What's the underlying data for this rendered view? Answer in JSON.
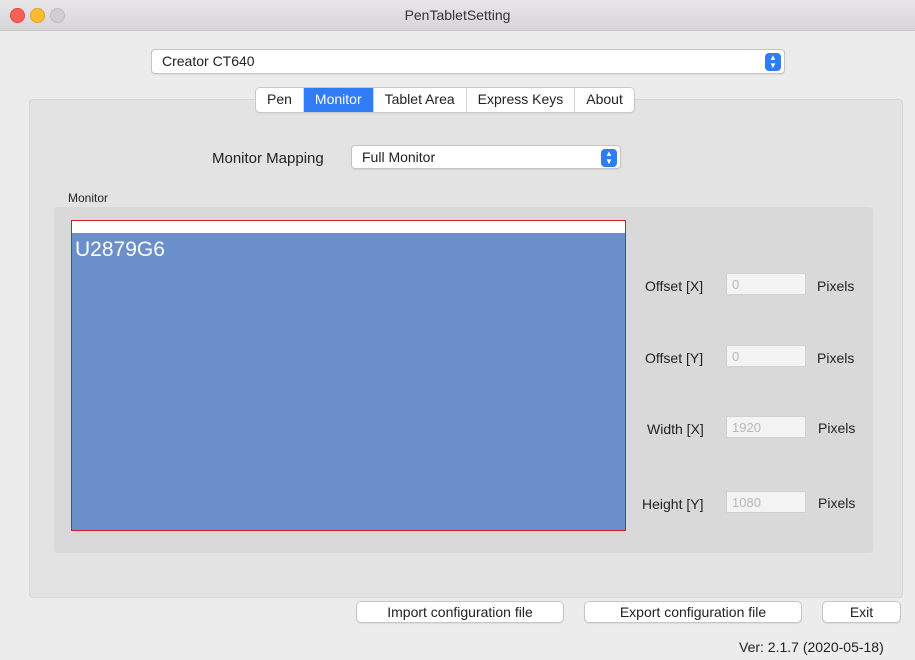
{
  "window": {
    "title": "PenTabletSetting"
  },
  "device_select": {
    "value": "Creator CT640",
    "arrow_icon": "up-down-chevron-icon"
  },
  "tabs": [
    {
      "label": "Pen",
      "active": false
    },
    {
      "label": "Monitor",
      "active": true
    },
    {
      "label": "Tablet Area",
      "active": false
    },
    {
      "label": "Express Keys",
      "active": false
    },
    {
      "label": "About",
      "active": false
    }
  ],
  "monitor_tab": {
    "mapping_label": "Monitor Mapping",
    "mapping_value": "Full Monitor",
    "group_label": "Monitor",
    "monitor_name": "U2879G6",
    "fields": [
      {
        "label": "Offset [X]",
        "placeholder": "0",
        "unit": "Pixels"
      },
      {
        "label": "Offset [Y]",
        "placeholder": "0",
        "unit": "Pixels"
      },
      {
        "label": "Width [X]",
        "placeholder": "1920",
        "unit": "Pixels"
      },
      {
        "label": "Height [Y]",
        "placeholder": "1080",
        "unit": "Pixels"
      }
    ]
  },
  "footer": {
    "import_label": "Import configuration file",
    "export_label": "Export configuration file",
    "exit_label": "Exit",
    "version": "Ver: 2.1.7 (2020-05-18)"
  },
  "colors": {
    "accent": "#2f7cf6",
    "monitor_fill": "#6a8fcb",
    "monitor_border": "#c8202b"
  }
}
